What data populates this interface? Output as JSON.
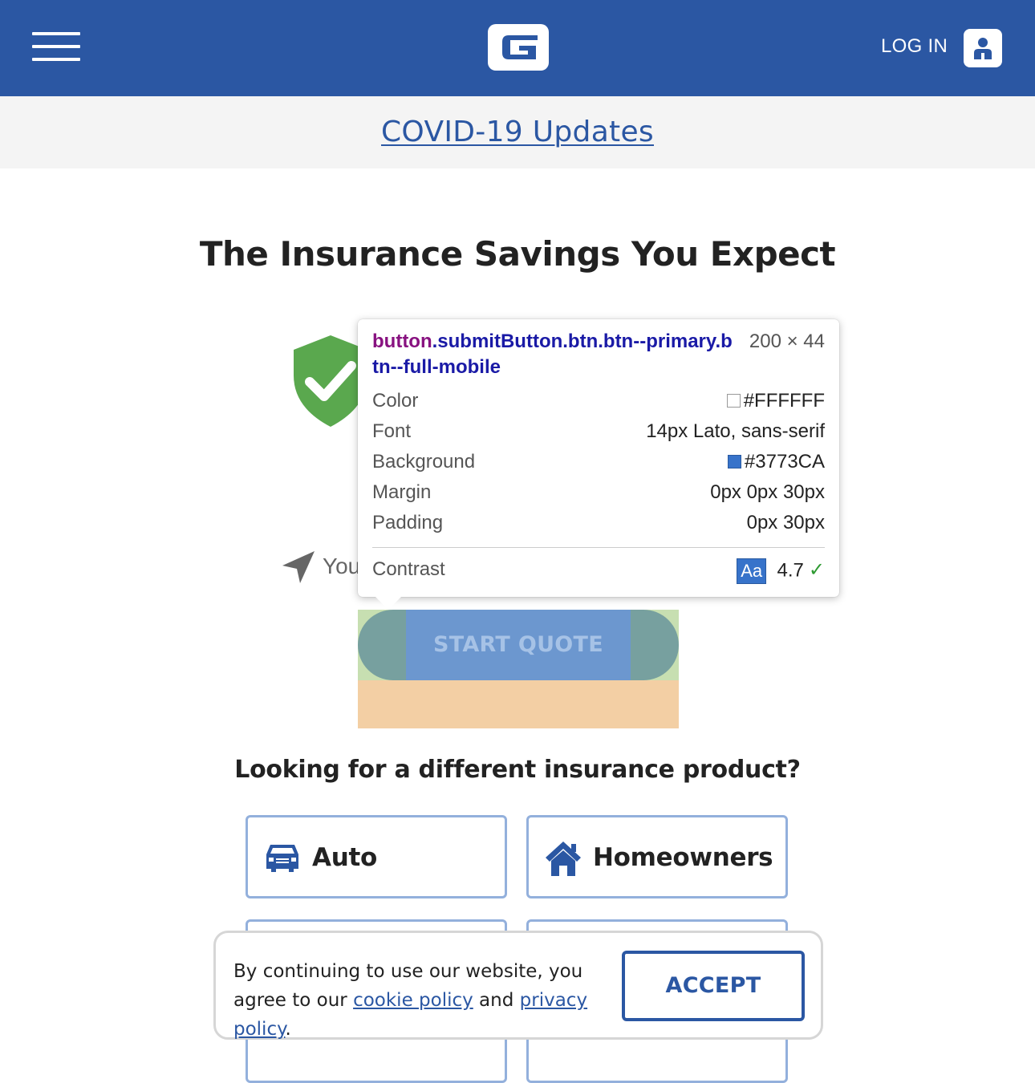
{
  "header": {
    "login_label": "LOG IN",
    "brand_color": "#2b57a3"
  },
  "covid": {
    "link_text": "COVID-19 Updates"
  },
  "hero": {
    "headline": "The Insurance Savings You Expect",
    "location_text": "You",
    "start_button": "START QUOTE"
  },
  "inspector": {
    "selector_tag": "button",
    "selector_classes": ".submitButton.btn.btn--primary.btn--full-mobile",
    "size": "200 × 44",
    "rows": [
      {
        "key": "Color",
        "value": "#FFFFFF",
        "swatch": "#FFFFFF"
      },
      {
        "key": "Font",
        "value": "14px Lato, sans-serif"
      },
      {
        "key": "Background",
        "value": "#3773CA",
        "swatch": "#3773CA"
      },
      {
        "key": "Margin",
        "value": "0px 0px 30px"
      },
      {
        "key": "Padding",
        "value": "0px 30px"
      }
    ],
    "contrast_label": "Contrast",
    "contrast_badge": "Aa",
    "contrast_value": "4.7"
  },
  "products": {
    "heading": "Looking for a different insurance product?",
    "items": [
      {
        "label": "Auto",
        "icon": "car-icon"
      },
      {
        "label": "Homeowners",
        "icon": "house-icon"
      }
    ]
  },
  "cookie": {
    "text_before": "By continuing to use our website, you agree to our ",
    "cookie_link": "cookie policy",
    "text_mid": " and ",
    "privacy_link": "privacy policy",
    "text_after": ".",
    "accept_label": "ACCEPT"
  }
}
